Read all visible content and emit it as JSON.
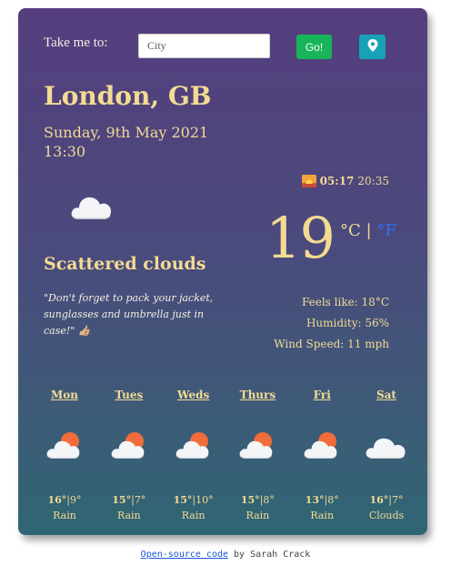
{
  "search": {
    "label": "Take me to:",
    "placeholder": "City",
    "value": "",
    "go_label": "Go!",
    "location_icon": "map-pin-icon"
  },
  "location": {
    "city": "London, GB",
    "date": "Sunday, 9th May 2021",
    "time": "13:30"
  },
  "sun": {
    "icon": "sunrise-icon",
    "sunrise": "05:17",
    "sunset": "20:35"
  },
  "current": {
    "icon": "cloud-icon",
    "description": "Scattered clouds",
    "quote": "\"Don't forget to pack your jacket, sunglasses and umbrella just in case!\" 👍🏼",
    "temperature": "19",
    "unit_c": "°C",
    "unit_sep": "|",
    "unit_f": "°F",
    "feels_like": "Feels like: 18°C",
    "humidity": "Humidity: 56%",
    "wind": "Wind Speed: 11 mph"
  },
  "forecast": [
    {
      "day": "Mon",
      "high": "16°",
      "low": "9°",
      "desc": "Rain",
      "icon": "sun-behind-cloud-icon"
    },
    {
      "day": "Tues",
      "high": "15°",
      "low": "7°",
      "desc": "Rain",
      "icon": "sun-behind-cloud-icon"
    },
    {
      "day": "Weds",
      "high": "15°",
      "low": "10°",
      "desc": "Rain",
      "icon": "sun-behind-cloud-icon"
    },
    {
      "day": "Thurs",
      "high": "15°",
      "low": "8°",
      "desc": "Rain",
      "icon": "sun-behind-cloud-icon"
    },
    {
      "day": "Fri",
      "high": "13°",
      "low": "8°",
      "desc": "Rain",
      "icon": "sun-behind-cloud-icon"
    },
    {
      "day": "Sat",
      "high": "16°",
      "low": "7°",
      "desc": "Clouds",
      "icon": "cloud-icon"
    }
  ],
  "footer": {
    "link_text": "Open-source code",
    "author": " by Sarah Crack"
  },
  "colors": {
    "accent": "#f3db93",
    "go_button": "#18b55a",
    "location_button": "#17a2b8",
    "fahrenheit": "#2f6df2"
  }
}
